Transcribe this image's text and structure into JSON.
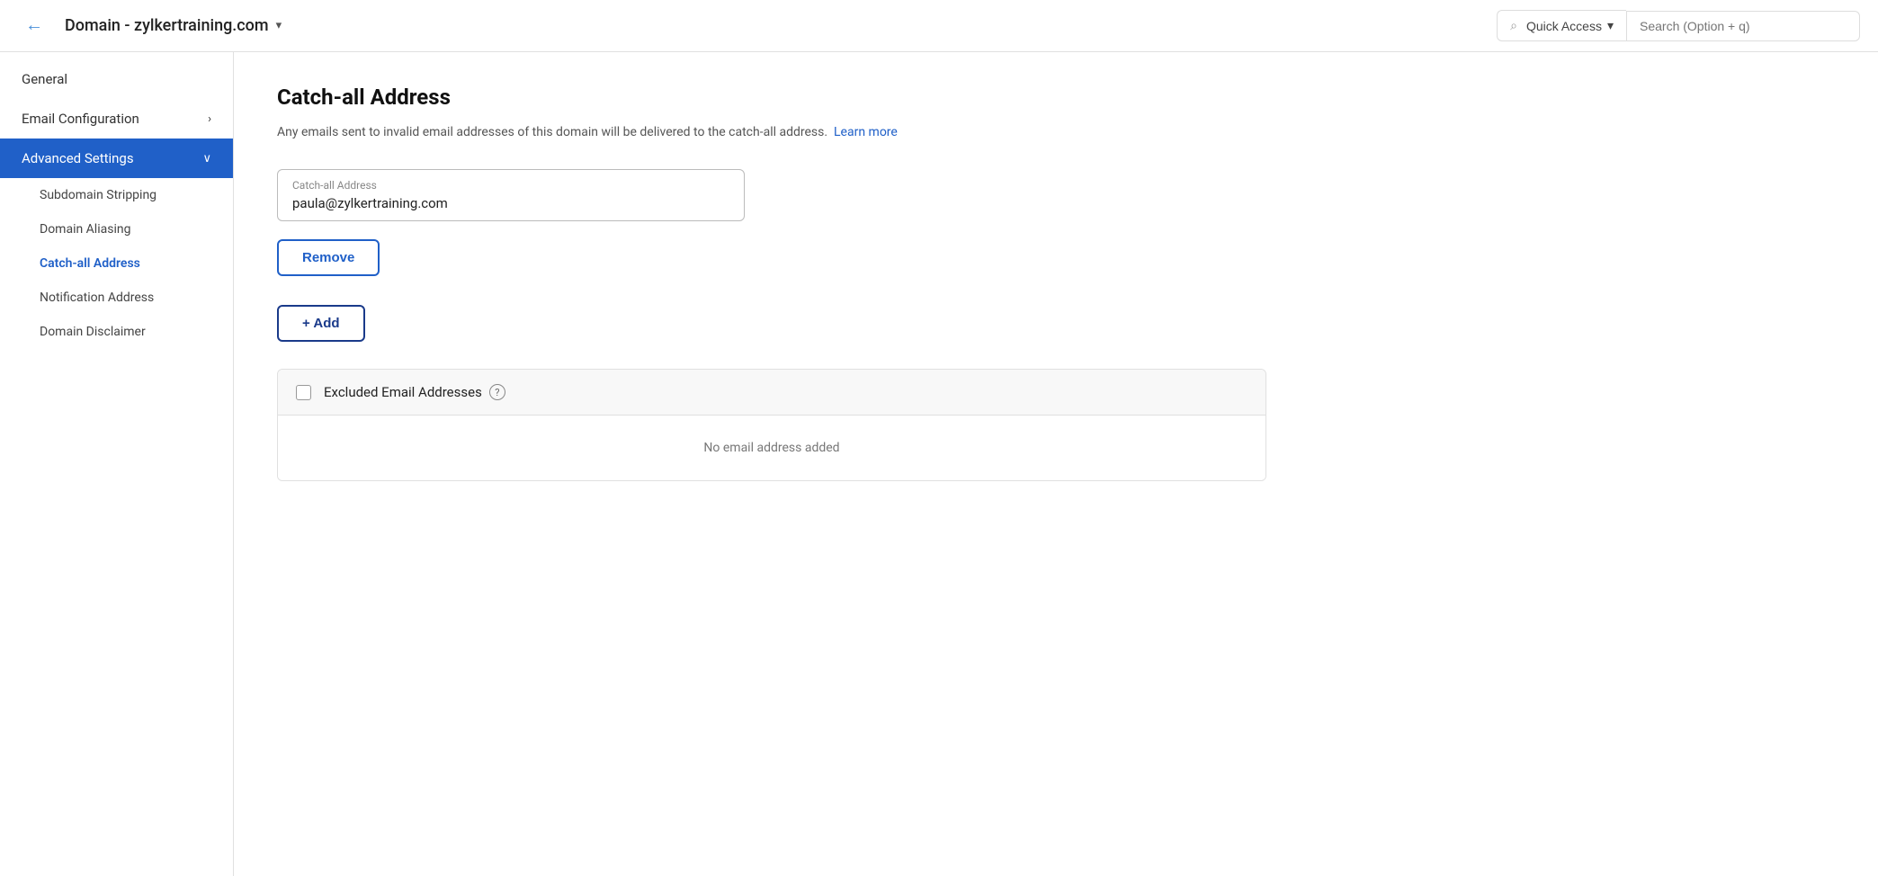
{
  "topbar": {
    "back_label": "←",
    "domain_title": "Domain - zylkertraining.com",
    "domain_chevron": "▾",
    "quick_access_label": "Quick Access",
    "quick_access_chevron": "▾",
    "search_placeholder": "Search (Option + q)"
  },
  "sidebar": {
    "items": [
      {
        "id": "general",
        "label": "General",
        "active": false,
        "has_arrow": false
      },
      {
        "id": "email-config",
        "label": "Email Configuration",
        "active": false,
        "has_arrow": true
      },
      {
        "id": "advanced-settings",
        "label": "Advanced Settings",
        "active": true,
        "has_arrow": true
      }
    ],
    "sub_items": [
      {
        "id": "subdomain-stripping",
        "label": "Subdomain Stripping",
        "active": false
      },
      {
        "id": "domain-aliasing",
        "label": "Domain Aliasing",
        "active": false
      },
      {
        "id": "catch-all-address",
        "label": "Catch-all Address",
        "active": true
      },
      {
        "id": "notification-address",
        "label": "Notification Address",
        "active": false
      },
      {
        "id": "domain-disclaimer",
        "label": "Domain Disclaimer",
        "active": false
      }
    ]
  },
  "main": {
    "page_title": "Catch-all Address",
    "page_desc": "Any emails sent to invalid email addresses of this domain will be delivered to the catch-all address.",
    "learn_more_label": "Learn more",
    "input_label": "Catch-all Address",
    "input_value": "paula@zylkertraining.com",
    "remove_button_label": "Remove",
    "add_button_label": "+ Add",
    "excluded_label": "Excluded Email Addresses",
    "excluded_empty": "No email address added"
  }
}
